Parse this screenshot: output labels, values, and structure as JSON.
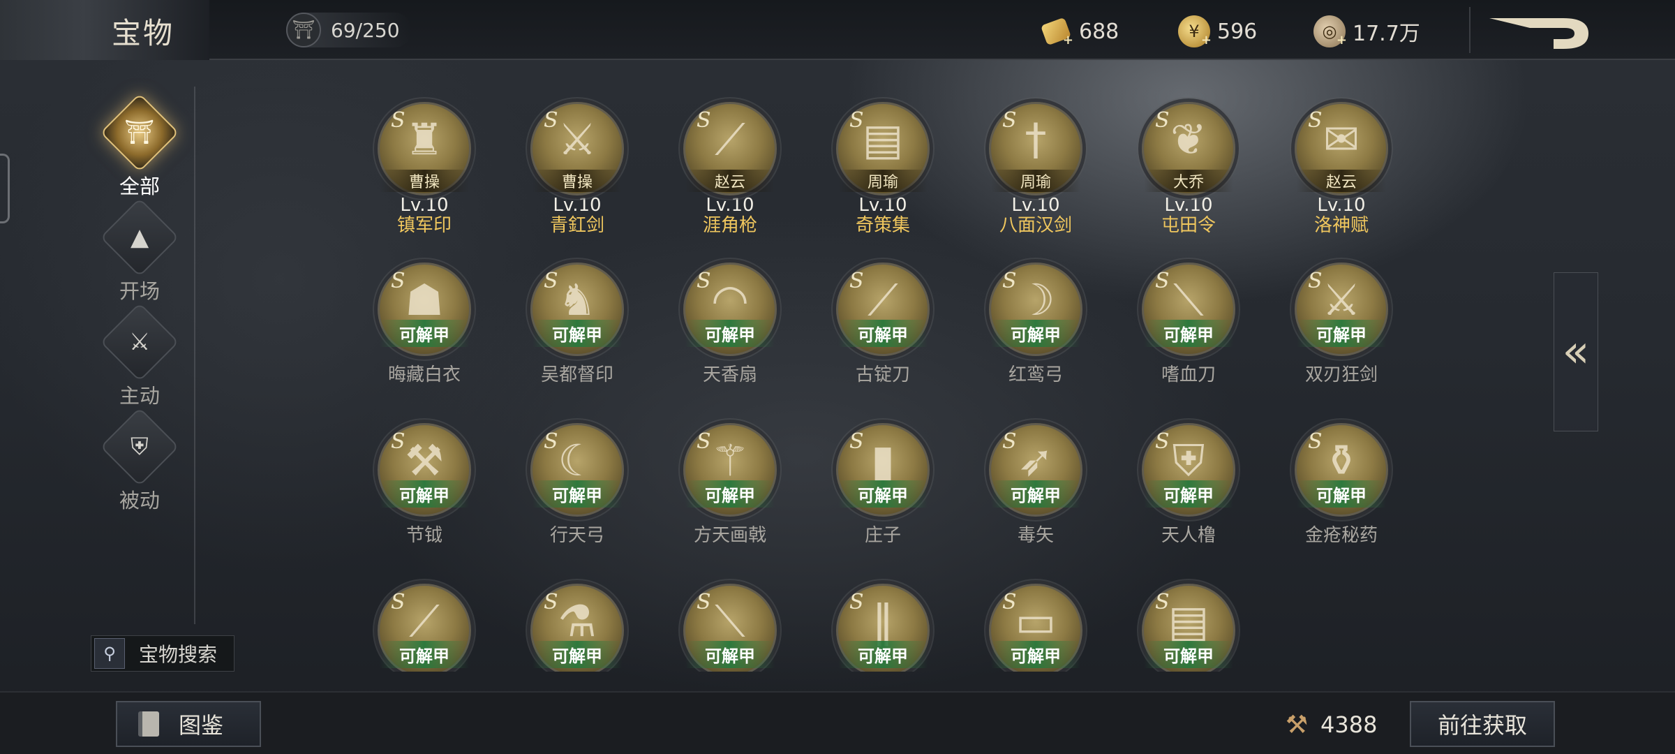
{
  "header": {
    "title": "宝物",
    "capacity": "69/250",
    "resources": [
      {
        "name": "gold-ingot",
        "value": "688"
      },
      {
        "name": "gold-coin",
        "value": "596"
      },
      {
        "name": "copper-coin",
        "value": "17.7万"
      }
    ]
  },
  "sidebar": {
    "items": [
      {
        "label": "全部",
        "icon": "all-treasure-icon",
        "active": true
      },
      {
        "label": "开场",
        "icon": "opening-icon",
        "active": false
      },
      {
        "label": "主动",
        "icon": "active-skill-icon",
        "active": false
      },
      {
        "label": "被动",
        "icon": "passive-skill-icon",
        "active": false
      }
    ],
    "search_label": "宝物搜索"
  },
  "grade": "S",
  "unlock_label": "可解甲",
  "owned": [
    {
      "hero": "曹操",
      "level": "Lv.10",
      "name": "镇军印"
    },
    {
      "hero": "曹操",
      "level": "Lv.10",
      "name": "青釭剑"
    },
    {
      "hero": "赵云",
      "level": "Lv.10",
      "name": "涯角枪"
    },
    {
      "hero": "周瑜",
      "level": "Lv.10",
      "name": "奇策集"
    },
    {
      "hero": "周瑜",
      "level": "Lv.10",
      "name": "八面汉剑"
    },
    {
      "hero": "大乔",
      "level": "Lv.10",
      "name": "屯田令"
    },
    {
      "hero": "赵云",
      "level": "Lv.10",
      "name": "洛神赋"
    }
  ],
  "locked_row1": [
    "晦藏白衣",
    "吴都督印",
    "天香扇",
    "古锭刀",
    "红鸾弓",
    "嗜血刀",
    "双刃狂剑"
  ],
  "locked_row2": [
    "节钺",
    "行天弓",
    "方天画戟",
    "庄子",
    "毒矢",
    "天人橹",
    "金疮秘药"
  ],
  "footer": {
    "codex_label": "图鉴",
    "cost_value": "4388",
    "goto_label": "前往获取"
  }
}
